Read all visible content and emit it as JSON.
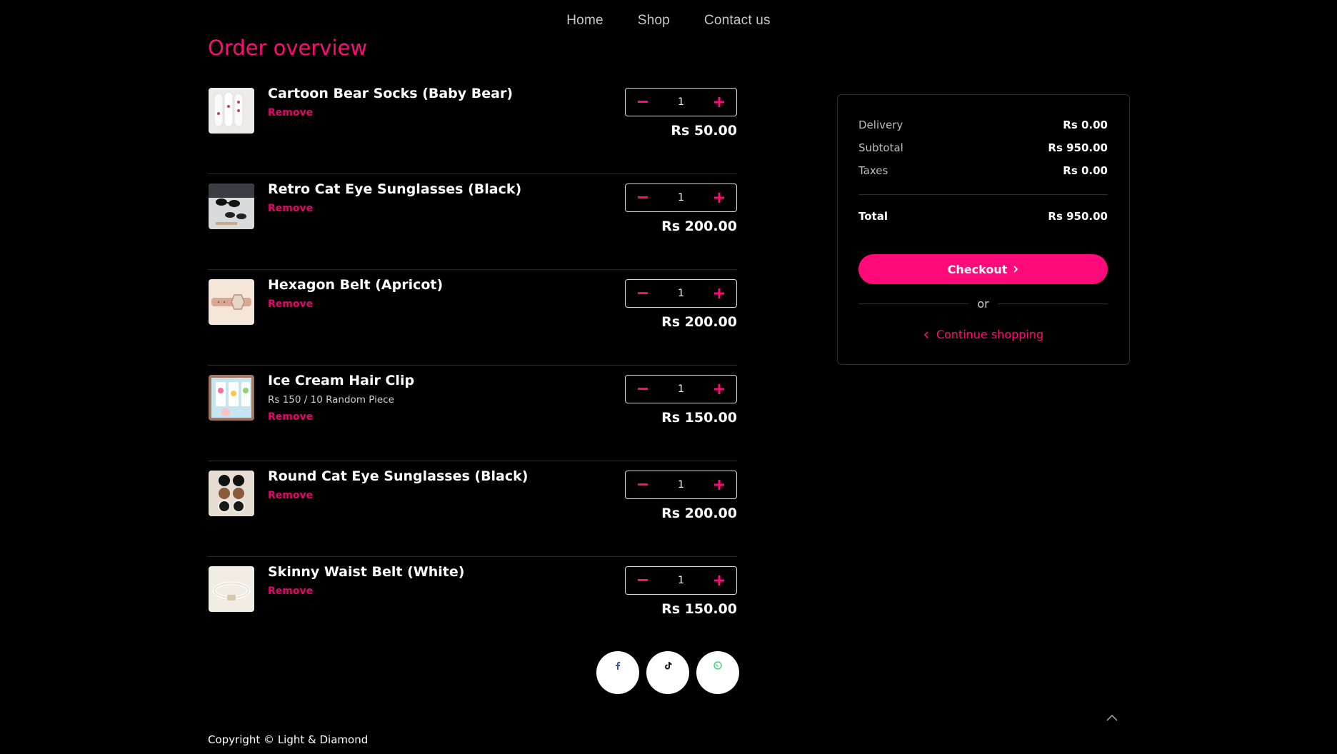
{
  "nav": {
    "items": [
      {
        "label": "Home"
      },
      {
        "label": "Shop"
      },
      {
        "label": "Contact us"
      }
    ]
  },
  "page": {
    "title": "Order overview"
  },
  "cart": {
    "items": [
      {
        "name": "Cartoon Bear Socks (Baby Bear)",
        "variant": "",
        "remove_label": "Remove",
        "quantity": "1",
        "price": "Rs 50.00",
        "thumb_icon": "socks-product-image"
      },
      {
        "name": "Retro Cat Eye Sunglasses (Black)",
        "variant": "",
        "remove_label": "Remove",
        "quantity": "1",
        "price": "Rs 200.00",
        "thumb_icon": "sunglasses-product-image"
      },
      {
        "name": "Hexagon Belt (Apricot)",
        "variant": "",
        "remove_label": "Remove",
        "quantity": "1",
        "price": "Rs 200.00",
        "thumb_icon": "belt-product-image"
      },
      {
        "name": "Ice Cream Hair Clip",
        "variant": "Rs 150 / 10 Random Piece",
        "remove_label": "Remove",
        "quantity": "1",
        "price": "Rs 150.00",
        "thumb_icon": "hair-clip-product-image"
      },
      {
        "name": "Round Cat Eye Sunglasses (Black)",
        "variant": "",
        "remove_label": "Remove",
        "quantity": "1",
        "price": "Rs 200.00",
        "thumb_icon": "round-sunglasses-product-image"
      },
      {
        "name": "Skinny Waist Belt (White)",
        "variant": "",
        "remove_label": "Remove",
        "quantity": "1",
        "price": "Rs 150.00",
        "thumb_icon": "white-belt-product-image"
      }
    ]
  },
  "summary": {
    "delivery_label": "Delivery",
    "delivery_value": "Rs 0.00",
    "subtotal_label": "Subtotal",
    "subtotal_value": "Rs 950.00",
    "taxes_label": "Taxes",
    "taxes_value": "Rs 0.00",
    "total_label": "Total",
    "total_value": "Rs 950.00",
    "checkout_label": "Checkout",
    "or_label": "or",
    "continue_label": "Continue shopping"
  },
  "social": {
    "icons": [
      "facebook-icon",
      "tiktok-icon",
      "whatsapp-icon"
    ]
  },
  "footer": {
    "copyright": "Copyright © Light & Diamond"
  },
  "colors": {
    "accent": "#ff0a78",
    "background": "#000000",
    "remove": "#e0076a"
  }
}
